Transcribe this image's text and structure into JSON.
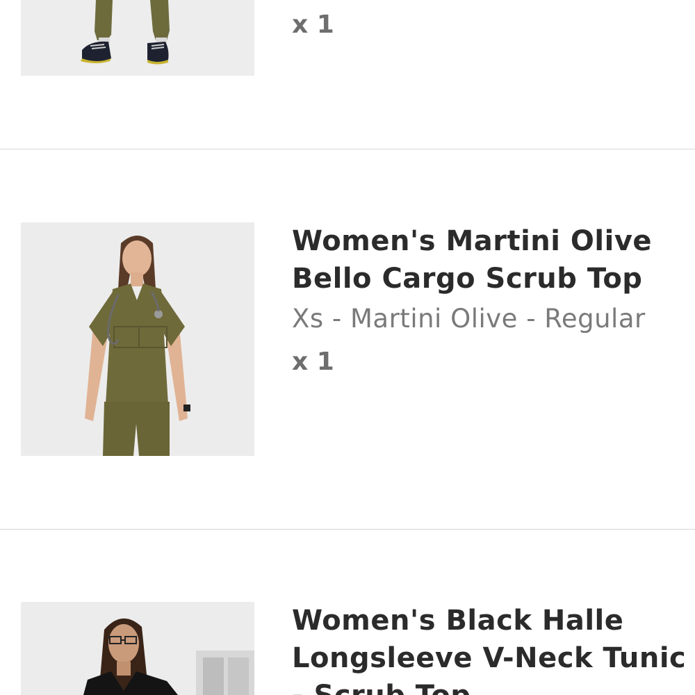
{
  "cart": {
    "items": [
      {
        "image_alt": "Women's olive jogger scrub pants with black sneakers",
        "quantity": "x 1"
      },
      {
        "title_line1": "Women's Martini Olive",
        "title_line2": "Bello Cargo Scrub Top",
        "variant": "Xs - Martini Olive - Regular",
        "quantity": "x 1",
        "image_alt": "Woman wearing olive scrub top with stethoscope"
      },
      {
        "title_line1": "Women's Black Halle",
        "title_line2": "Longsleeve V-Neck Tunic",
        "title_line3": "- Scrub Top",
        "image_alt": "Woman wearing black scrub top with glasses"
      }
    ]
  },
  "colors": {
    "olive": "#6f6a3a",
    "thumb_bg": "#ececec",
    "divider": "#d6d6d6",
    "title_text": "#2b2b2b",
    "variant_text": "#7a7a7a"
  }
}
